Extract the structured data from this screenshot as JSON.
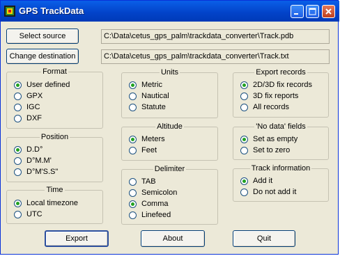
{
  "window": {
    "title": "GPS TrackData"
  },
  "source": {
    "button": "Select source",
    "path": "C:\\Data\\cetus_gps_palm\\trackdata_converter\\Track.pdb"
  },
  "destination": {
    "button": "Change destination",
    "path": "C:\\Data\\cetus_gps_palm\\trackdata_converter\\Track.txt"
  },
  "format": {
    "title": "Format",
    "options": [
      "User defined",
      "GPX",
      "IGC",
      "DXF"
    ],
    "selected": "User defined"
  },
  "position": {
    "title": "Position",
    "options": [
      "D.D°",
      "D°M.M'",
      "D°M'S.S\""
    ],
    "selected": "D.D°"
  },
  "time": {
    "title": "Time",
    "options": [
      "Local timezone",
      "UTC"
    ],
    "selected": "Local timezone"
  },
  "units": {
    "title": "Units",
    "options": [
      "Metric",
      "Nautical",
      "Statute"
    ],
    "selected": "Metric"
  },
  "altitude": {
    "title": "Altitude",
    "options": [
      "Meters",
      "Feet"
    ],
    "selected": "Meters"
  },
  "delimiter": {
    "title": "Delimiter",
    "options": [
      "TAB",
      "Semicolon",
      "Comma",
      "Linefeed"
    ],
    "selected": "Comma"
  },
  "export_records": {
    "title": "Export records",
    "options": [
      "2D/3D fix records",
      "3D fix reports",
      "All records"
    ],
    "selected": "2D/3D fix records"
  },
  "no_data": {
    "title": "'No data' fields",
    "options": [
      "Set as empty",
      "Set to zero"
    ],
    "selected": "Set as empty"
  },
  "track_info": {
    "title": "Track information",
    "options": [
      "Add it",
      "Do not add it"
    ],
    "selected": "Add it"
  },
  "actions": {
    "export": "Export",
    "about": "About",
    "quit": "Quit"
  },
  "colors": {
    "titlebar": "#0a5fe8",
    "face": "#ece9d8",
    "radio_dot": "#21a121"
  },
  "icons": {
    "app": "gps-app-icon",
    "minimize": "minimize-icon",
    "maximize": "maximize-icon",
    "close": "close-icon"
  }
}
